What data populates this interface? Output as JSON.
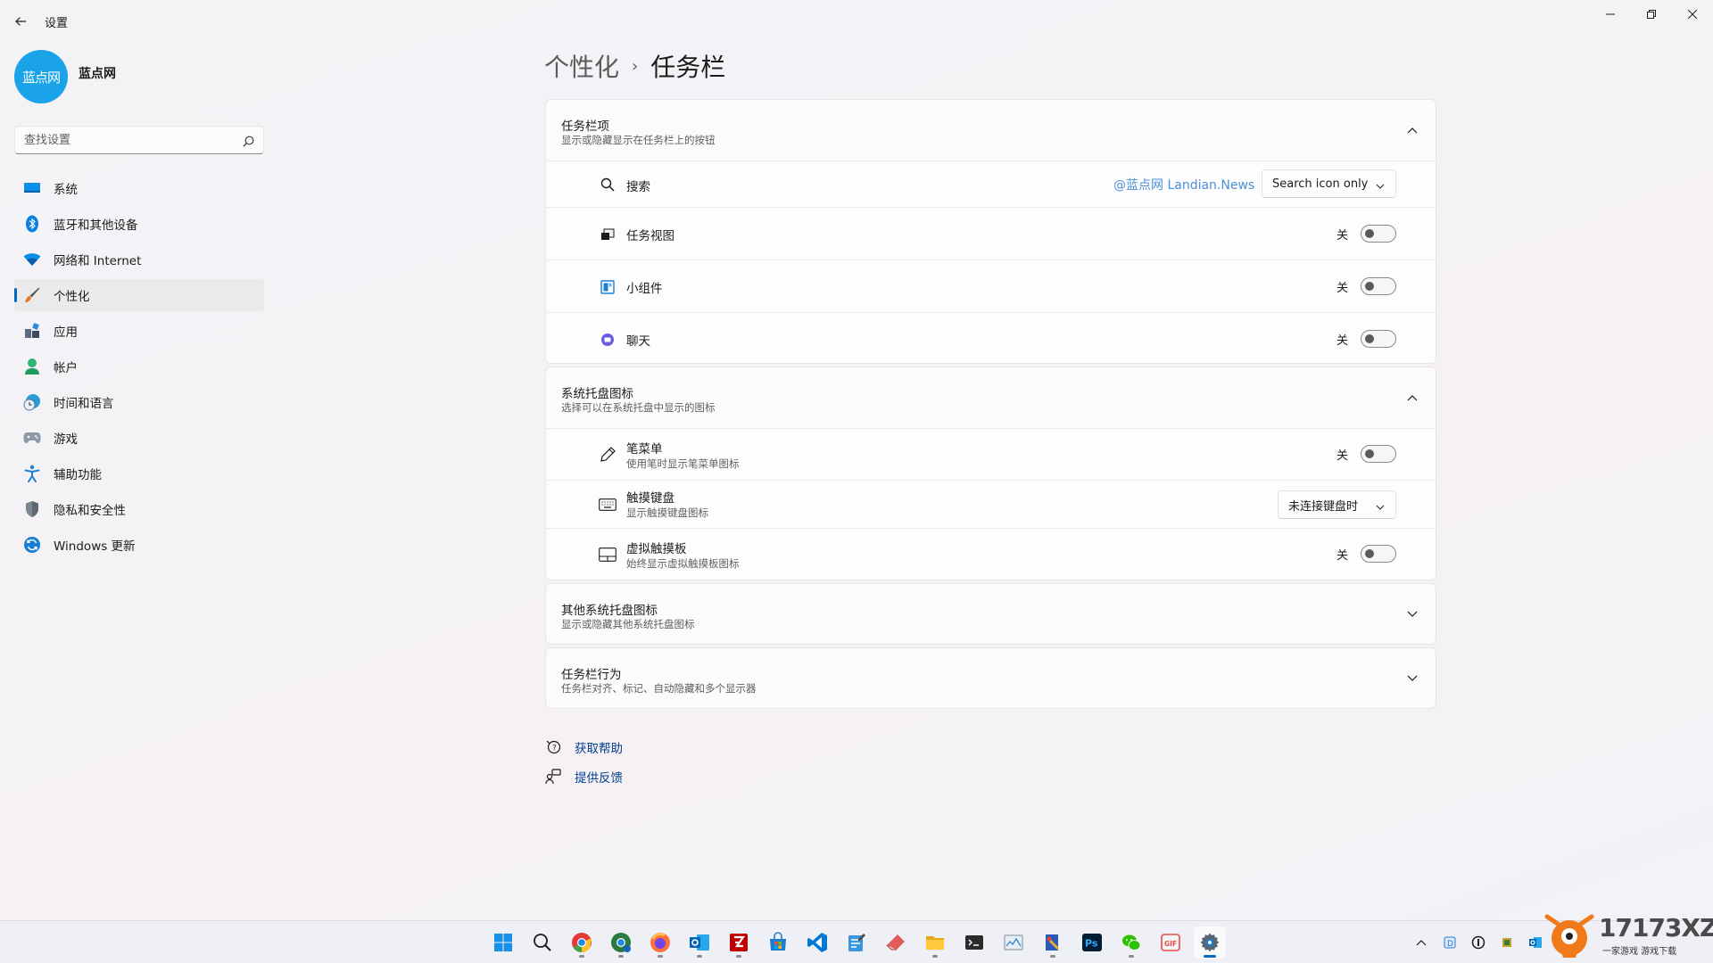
{
  "window": {
    "app_title": "设置",
    "controls": [
      "minimize",
      "maximize",
      "close"
    ]
  },
  "profile": {
    "avatar_text": "蓝点网",
    "name": "蓝点网"
  },
  "search": {
    "placeholder": "查找设置",
    "value": ""
  },
  "sidebar": {
    "items": [
      {
        "label": "系统",
        "icon": "monitor-icon"
      },
      {
        "label": "蓝牙和其他设备",
        "icon": "bluetooth-icon"
      },
      {
        "label": "网络和 Internet",
        "icon": "wifi-icon"
      },
      {
        "label": "个性化",
        "icon": "brush-icon",
        "active": true
      },
      {
        "label": "应用",
        "icon": "apps-icon"
      },
      {
        "label": "帐户",
        "icon": "person-icon"
      },
      {
        "label": "时间和语言",
        "icon": "clock-globe-icon"
      },
      {
        "label": "游戏",
        "icon": "gamepad-icon"
      },
      {
        "label": "辅助功能",
        "icon": "accessibility-icon"
      },
      {
        "label": "隐私和安全性",
        "icon": "shield-icon"
      },
      {
        "label": "Windows 更新",
        "icon": "update-icon"
      }
    ]
  },
  "breadcrumb": {
    "parent": "个性化",
    "separator": "›",
    "current": "任务栏"
  },
  "taskbar_items": {
    "title": "任务栏项",
    "subtitle": "显示或隐藏显示在任务栏上的按钮",
    "rows": {
      "search": {
        "label": "搜索",
        "watermark": "@蓝点网 Landian.News",
        "dropdown_value": "Search icon only"
      },
      "task_view": {
        "label": "任务视图",
        "state_label": "关",
        "on": false
      },
      "widgets": {
        "label": "小组件",
        "state_label": "关",
        "on": false
      },
      "chat": {
        "label": "聊天",
        "state_label": "关",
        "on": false
      }
    }
  },
  "tray_icons": {
    "title": "系统托盘图标",
    "subtitle": "选择可以在系统托盘中显示的图标",
    "rows": {
      "pen_menu": {
        "label": "笔菜单",
        "sub": "使用笔时显示笔菜单图标",
        "state_label": "关",
        "on": false
      },
      "touch_keyboard": {
        "label": "触摸键盘",
        "sub": "显示触摸键盘图标",
        "dropdown_value": "未连接键盘时"
      },
      "virtual_touchpad": {
        "label": "虚拟触摸板",
        "sub": "始终显示虚拟触摸板图标",
        "state_label": "关",
        "on": false
      }
    }
  },
  "other_tray": {
    "title": "其他系统托盘图标",
    "subtitle": "显示或隐藏其他系统托盘图标"
  },
  "behaviors": {
    "title": "任务栏行为",
    "subtitle": "任务栏对齐、标记、自动隐藏和多个显示器"
  },
  "links": {
    "help": "获取帮助",
    "feedback": "提供反馈"
  },
  "taskbar": {
    "apps": [
      "start-icon",
      "search-icon",
      "chrome-icon",
      "chrome-beta-icon",
      "firefox-icon",
      "outlook-icon",
      "filezilla-icon",
      "store-icon",
      "vscode-icon",
      "notepad-icon",
      "eraser-icon",
      "file-explorer-icon",
      "terminal-icon",
      "resource-monitor-icon",
      "paint-icon",
      "photoshop-icon",
      "wechat-icon",
      "gif-tool-icon",
      "settings-icon"
    ],
    "active_app": "settings-icon"
  },
  "logo_watermark": {
    "number": "17173XZ",
    "sub": "一家游戏  游戏下载"
  },
  "colors": {
    "accent": "#0067c0",
    "avatar": "#1aa3e8",
    "link": "#003e92"
  }
}
